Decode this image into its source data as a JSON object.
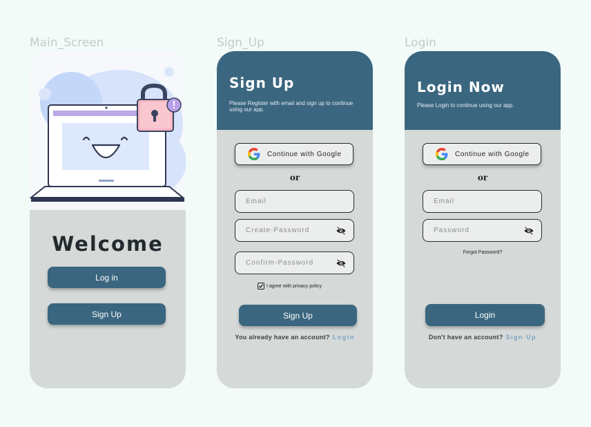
{
  "frames": {
    "main": "Main_Screen",
    "signup": "Sign_Up",
    "login": "Login"
  },
  "main_screen": {
    "title": "Welcome",
    "login_button": "Log in",
    "signup_button": "Sign Up"
  },
  "signup_screen": {
    "title": "Sign Up",
    "subtitle": "Please Register with email and sign up to continue using our app.",
    "google_button": "Continue with Google",
    "or": "or",
    "email_placeholder": "Email",
    "create_password_placeholder": "Create-Password",
    "confirm_password_placeholder": "Confirm-Password",
    "agree_text": "I agree with privacy policy",
    "submit_button": "Sign Up",
    "footer_text": "You already have an account?",
    "footer_link": "Login"
  },
  "login_screen": {
    "title": "Login Now",
    "subtitle": "Please Login to continue using our app.",
    "google_button": "Continue with Google",
    "or": "or",
    "email_placeholder": "Email",
    "password_placeholder": "Password",
    "forgot": "Forgot Password?",
    "submit_button": "Login",
    "footer_text": "Don't have an account?",
    "footer_link": "Sign Up"
  },
  "colors": {
    "background": "#f2fbf8",
    "phone": "#d5d9d8",
    "primary": "#3b6680",
    "link": "#7ca3c4"
  },
  "icons": [
    "google-icon",
    "eye-off-icon",
    "checkbox-icon",
    "laptop-illustration",
    "padlock-illustration"
  ]
}
